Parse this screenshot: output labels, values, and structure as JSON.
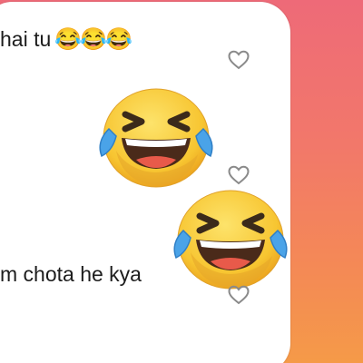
{
  "messages": [
    {
      "text": "hai tu",
      "emoji": "😂😂😂"
    },
    {
      "text": "m chota he kya"
    }
  ],
  "sticker_icon": "laughing-tears-emoji",
  "reaction_icon": "heart-outline-icon",
  "colors": {
    "panel": "#ffffff",
    "background_top": "#ee6a78",
    "background_bottom": "#f59a48",
    "text": "#1d1d1d",
    "heart_outline": "#8a8a8a",
    "emoji_face": "#f7c531",
    "emoji_tears": "#4aa3e8"
  }
}
